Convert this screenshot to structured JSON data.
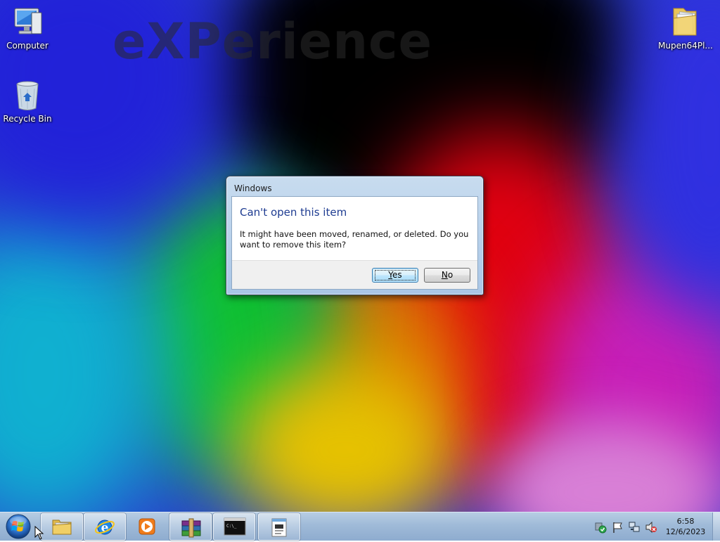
{
  "desktop": {
    "wallpaper_text": "eXPerience",
    "icons": [
      {
        "label": "Computer"
      },
      {
        "label": "Recycle Bin"
      },
      {
        "label": "Mupen64Pl..."
      }
    ]
  },
  "dialog": {
    "title": "Windows",
    "main_instruction": "Can't open this item",
    "body": "It might have been moved, renamed, or deleted. Do you want to remove this item?",
    "yes": {
      "accel": "Y",
      "rest": "es"
    },
    "no": {
      "accel": "N",
      "rest": "o"
    }
  },
  "taskbar": {
    "pinned": [
      "start-button",
      "windows-explorer",
      "internet-explorer",
      "media-player",
      "winrar",
      "command-prompt",
      "notepad"
    ],
    "tray_icons": [
      "action-center-icon",
      "flag-icon",
      "network-icon",
      "volume-muted-icon"
    ],
    "clock": {
      "time": "6:58",
      "date": "12/6/2023"
    }
  },
  "colors": {
    "dialog_instruction": "#1e3c91",
    "taskbar": "#9fbad8"
  }
}
